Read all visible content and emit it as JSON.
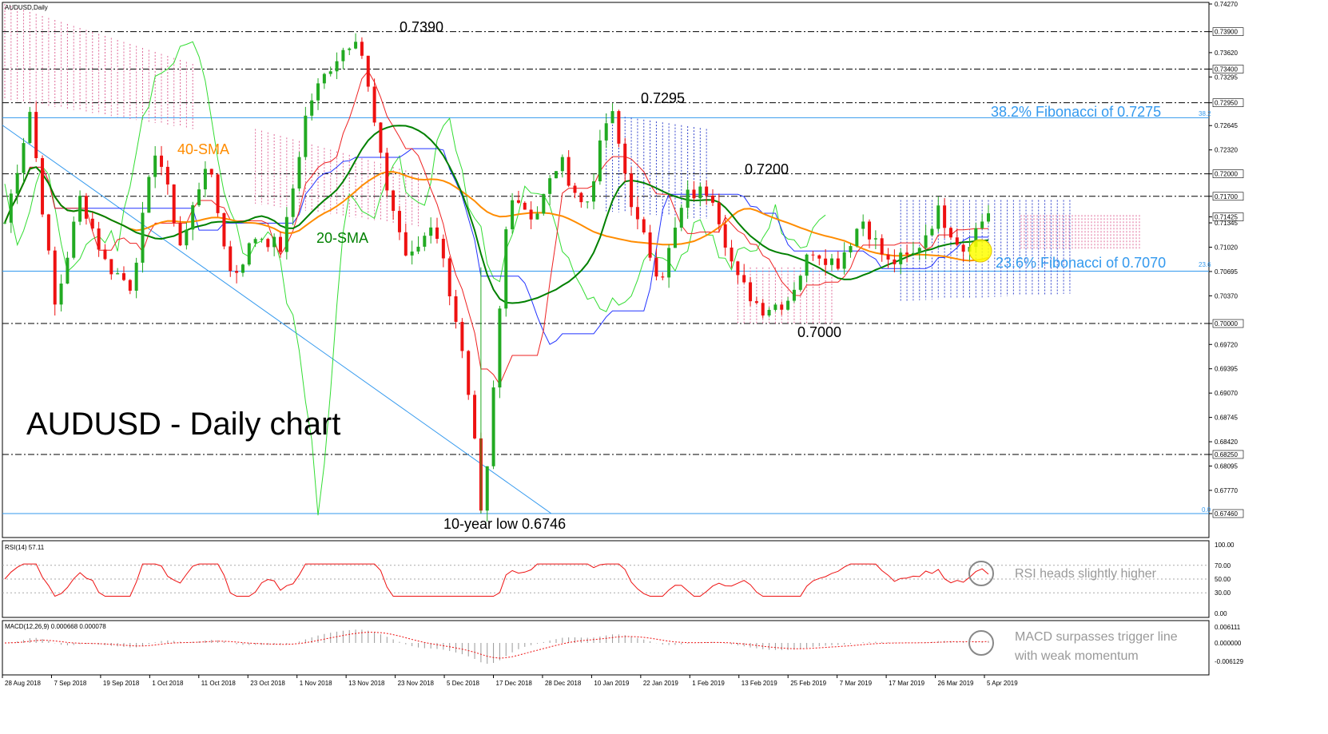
{
  "symbol_label": "AUDUSD,Daily",
  "title_overlay": "AUDUSD - Daily chart",
  "chart_data": [
    {
      "type": "candlestick",
      "symbol": "AUDUSD",
      "timeframe": "Daily",
      "ylim": [
        0.6746,
        0.7427
      ],
      "y_ticks": [
        "0.74270",
        "0.73900",
        "0.73620",
        "0.73400",
        "0.73295",
        "0.72950",
        "0.72645",
        "0.72320",
        "0.72000",
        "0.71700",
        "0.71425",
        "0.71345",
        "0.71020",
        "0.70695",
        "0.70370",
        "0.70000",
        "0.69720",
        "0.69395",
        "0.69070",
        "0.68745",
        "0.68420",
        "0.68250",
        "0.68095",
        "0.67770",
        "0.67460"
      ],
      "highlight_ticks": [
        "0.73900",
        "0.73400",
        "0.72950",
        "0.72000",
        "0.71700",
        "0.71425",
        "0.70000",
        "0.68250",
        "0.67460"
      ],
      "x_ticks": [
        "28 Aug 2018",
        "7 Sep 2018",
        "19 Sep 2018",
        "1 Oct 2018",
        "11 Oct 2018",
        "23 Oct 2018",
        "1 Nov 2018",
        "13 Nov 2018",
        "23 Nov 2018",
        "5 Dec 2018",
        "17 Dec 2018",
        "28 Dec 2018",
        "10 Jan 2019",
        "22 Jan 2019",
        "1 Feb 2019",
        "13 Feb 2019",
        "25 Feb 2019",
        "7 Mar 2019",
        "17 Mar 2019",
        "26 Mar 2019",
        "5 Apr 2019"
      ],
      "key_points": [
        0.7135,
        0.7285,
        0.702,
        0.717,
        0.708,
        0.705,
        0.724,
        0.71,
        0.722,
        0.706,
        0.712,
        0.71,
        0.729,
        0.735,
        0.739,
        0.72,
        0.708,
        0.714,
        0.699,
        0.6746,
        0.718,
        0.714,
        0.722,
        0.715,
        0.729,
        0.714,
        0.706,
        0.717,
        0.718,
        0.706,
        0.702,
        0.703,
        0.71,
        0.708,
        0.714,
        0.708,
        0.709,
        0.715,
        0.71,
        0.715
      ],
      "series": [
        {
          "name": "20-SMA",
          "color": "#008000"
        },
        {
          "name": "40-SMA",
          "color": "#ff8c00"
        }
      ],
      "horizontal_levels": [
        0.739,
        0.734,
        0.7295,
        0.72,
        0.717,
        0.7,
        0.6825,
        0.6746
      ],
      "fibonacci": [
        {
          "label": "38.2% Fibonacci of 0.7275",
          "value": 0.7275,
          "tag": "38.2"
        },
        {
          "label": "23.6% Fibonacci of 0.7070",
          "value": 0.707,
          "tag": "23.6"
        },
        {
          "tag": "0.0",
          "value": 0.6746
        }
      ],
      "annotations": [
        {
          "text": "0.7390"
        },
        {
          "text": "0.7295"
        },
        {
          "text": "0.7200"
        },
        {
          "text": "0.7000"
        },
        {
          "text": "10-year low 0.6746"
        },
        {
          "text": "40-SMA"
        },
        {
          "text": "20-SMA"
        }
      ]
    },
    {
      "type": "line",
      "name": "RSI(14)",
      "header": "RSI(14) 57.11",
      "ylim": [
        0,
        100
      ],
      "y_ticks": [
        "100.00",
        "70.00",
        "50.00",
        "30.00",
        "0.00"
      ],
      "last_value": 57.11,
      "annotation": "RSI heads slightly higher"
    },
    {
      "type": "histogram",
      "name": "MACD(12,26,9)",
      "header": "MACD(12,26,9) 0.000668 0.000078",
      "y_ticks": [
        "0.006111",
        "0.000000",
        "-0.006129"
      ],
      "annotation_lines": [
        "MACD surpasses trigger line",
        "with weak momentum"
      ]
    }
  ]
}
